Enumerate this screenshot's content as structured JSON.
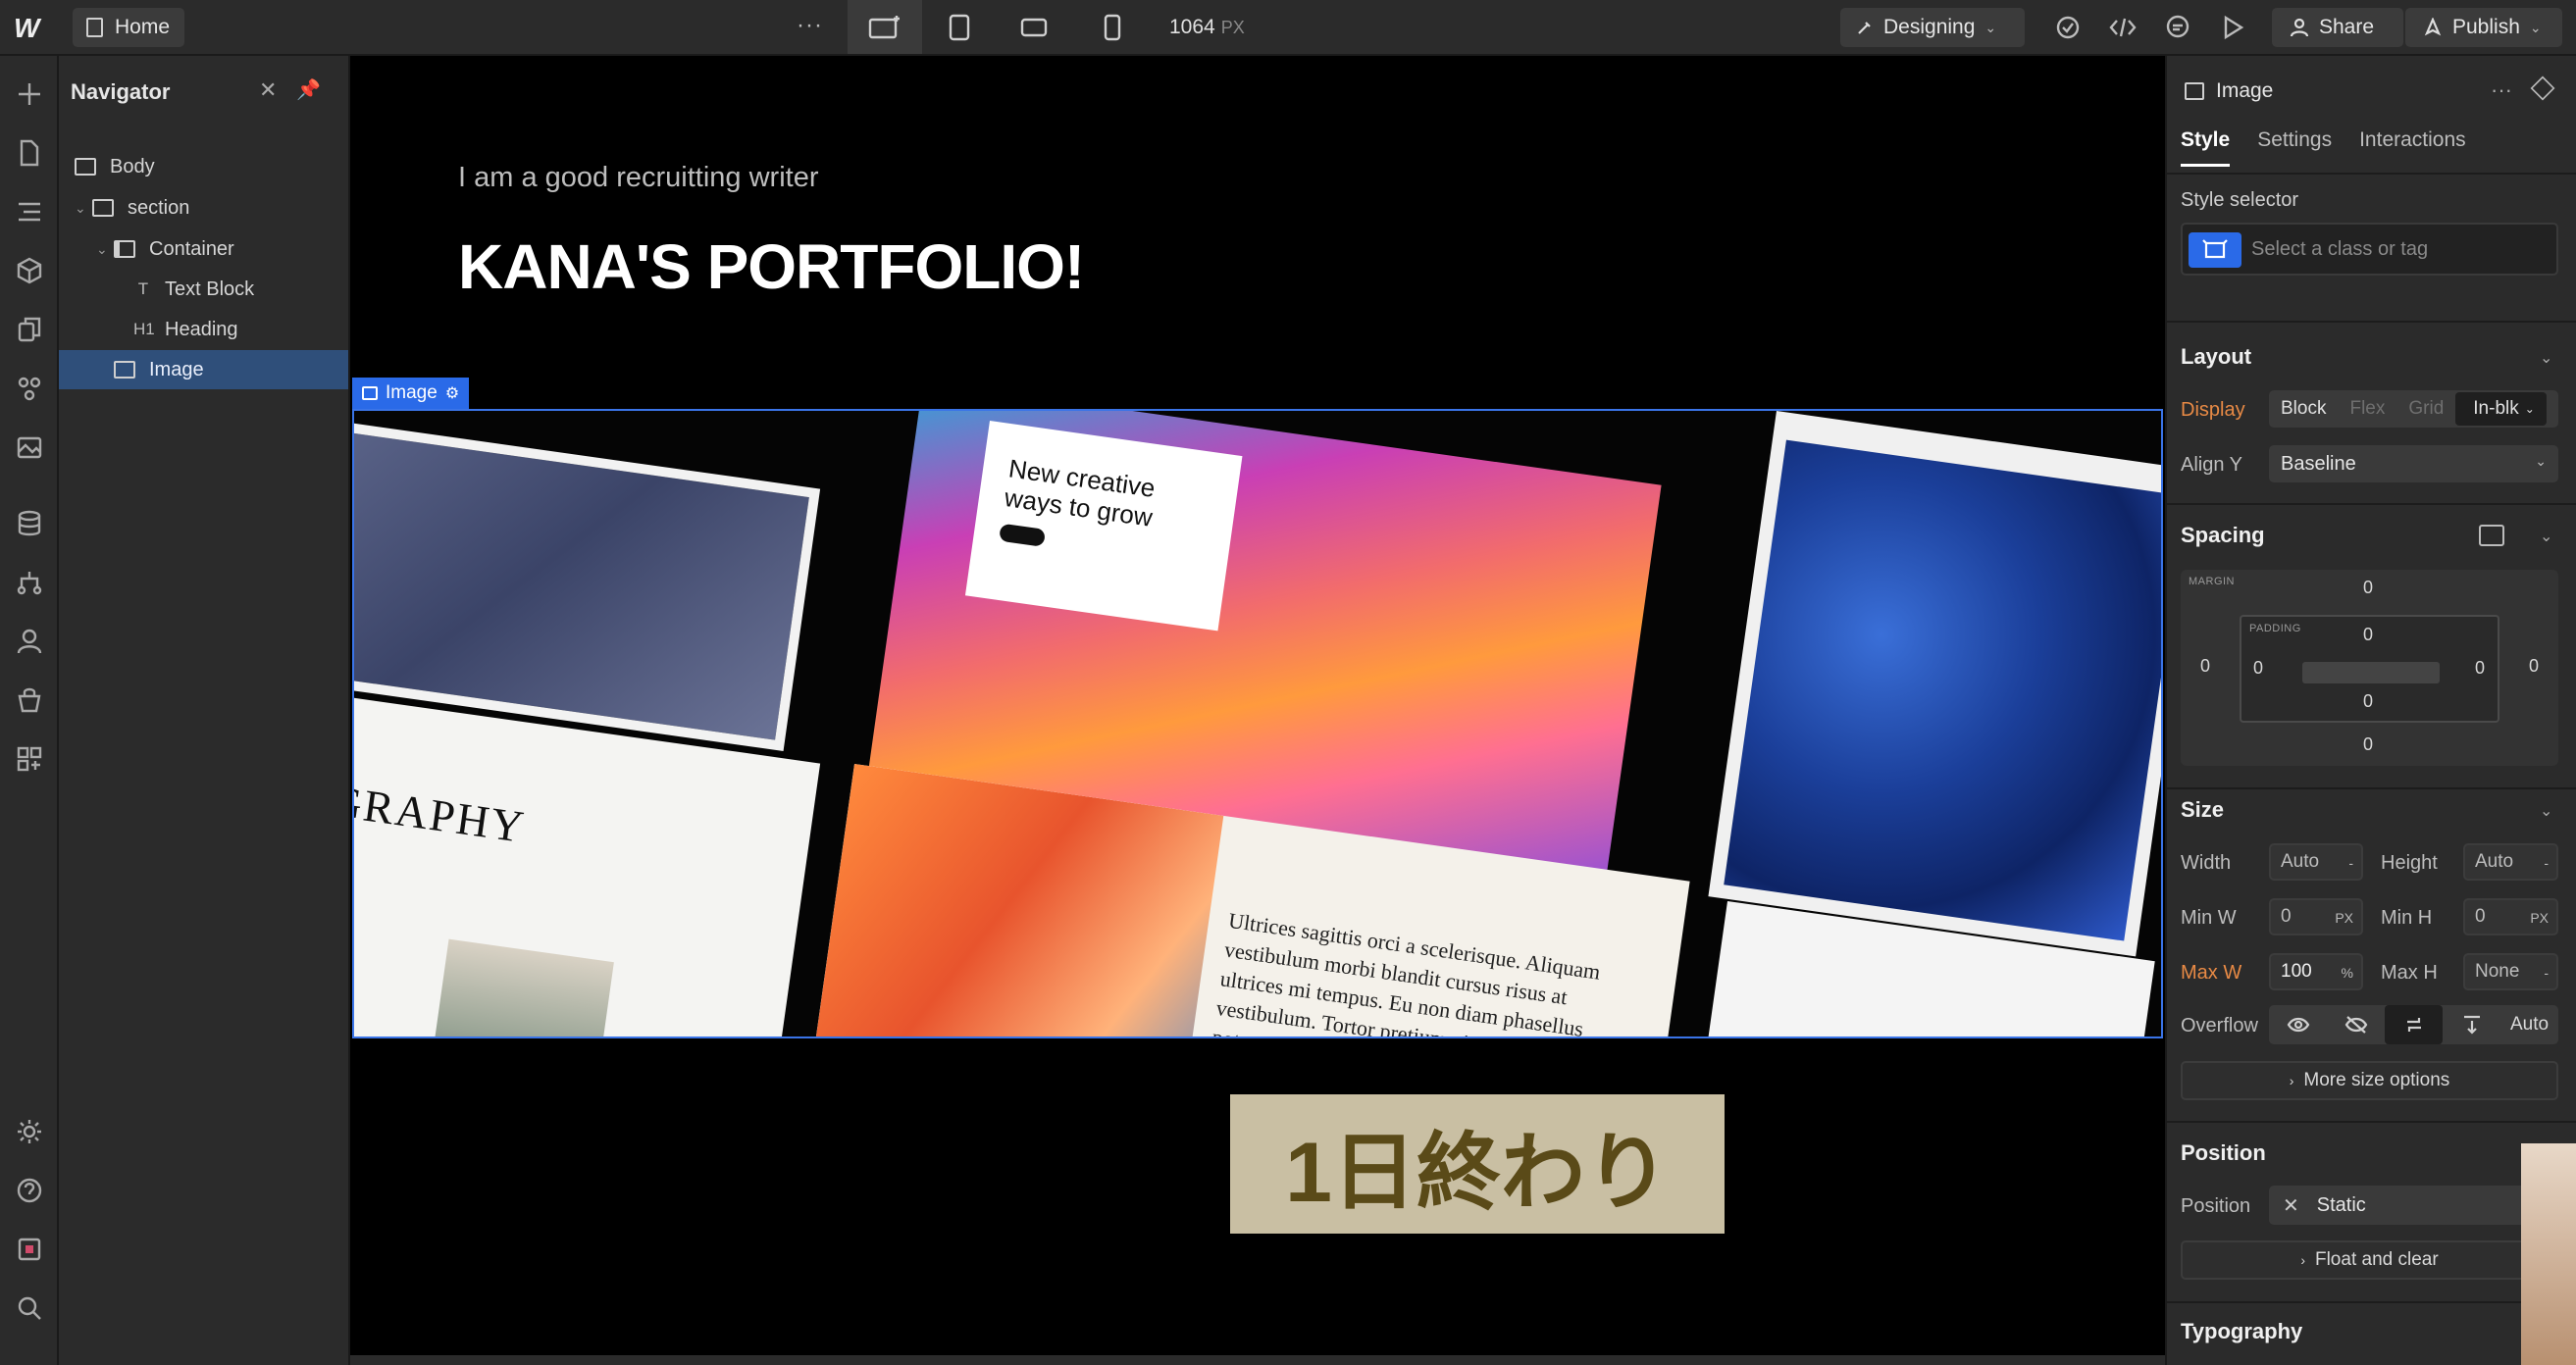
{
  "topbar": {
    "logo": "W",
    "home_label": "Home",
    "more": "···",
    "width_value": "1064",
    "width_unit": "PX",
    "mode_label": "Designing",
    "share_label": "Share",
    "publish_label": "Publish"
  },
  "navigator": {
    "title": "Navigator",
    "items": [
      {
        "label": "Body",
        "icon": "box-icon"
      },
      {
        "label": "section",
        "icon": "box-icon"
      },
      {
        "label": "Container",
        "icon": "container-icon"
      },
      {
        "label": "Text Block",
        "icon": "text-icon",
        "tag": "T"
      },
      {
        "label": "Heading",
        "icon": "heading-icon",
        "tag": "H1"
      },
      {
        "label": "Image",
        "icon": "image-icon",
        "selected": true
      }
    ]
  },
  "canvas": {
    "subtitle": "I am a good  recruitting writer",
    "title": "KANA'S PORTFOLIO!",
    "image_tag": "Image",
    "card_text": "New creative ways to grow",
    "typo_text": "GRAPHY",
    "marble_text": "Ultrices sagittis orci a scelerisque. Aliquam vestibulum morbi blandit cursus risus at ultrices mi tempus. Eu non diam phasellus vestibulum. Tortor pretium viverra suspendisse potenti nullam ac tortor vitae. Id faucibus nisl tincidunt eget nullam non nisi est. Vitae purus faucibus suspendisse sed.",
    "overlay_text": "1日終わり"
  },
  "panel": {
    "element_label": "Image",
    "tabs": [
      "Style",
      "Settings",
      "Interactions"
    ],
    "style_selector_label": "Style selector",
    "style_selector_placeholder": "Select a class or tag",
    "layout": {
      "title": "Layout",
      "display_label": "Display",
      "display_options": [
        "Block",
        "Flex",
        "Grid",
        "In-blk"
      ],
      "align_label": "Align Y",
      "align_value": "Baseline"
    },
    "spacing": {
      "title": "Spacing",
      "margin_label": "MARGIN",
      "padding_label": "PADDING",
      "margin": {
        "top": "0",
        "right": "0",
        "bottom": "0",
        "left": "0"
      },
      "padding": {
        "top": "0",
        "right": "0",
        "bottom": "0",
        "left": "0"
      }
    },
    "size": {
      "title": "Size",
      "width_label": "Width",
      "width_value": "Auto",
      "height_label": "Height",
      "height_value": "Auto",
      "minw_label": "Min W",
      "minw_value": "0",
      "minw_unit": "PX",
      "minh_label": "Min H",
      "minh_value": "0",
      "minh_unit": "PX",
      "maxw_label": "Max W",
      "maxw_value": "100",
      "maxw_unit": "%",
      "maxh_label": "Max H",
      "maxh_value": "None",
      "overflow_label": "Overflow",
      "overflow_auto": "Auto",
      "more_label": "More size options"
    },
    "position": {
      "title": "Position",
      "position_label": "Position",
      "position_value": "Static",
      "float_label": "Float and clear"
    },
    "typography": {
      "title": "Typography"
    }
  },
  "colors": {
    "accent": "#2a6ae8",
    "modified": "#e88a45"
  }
}
